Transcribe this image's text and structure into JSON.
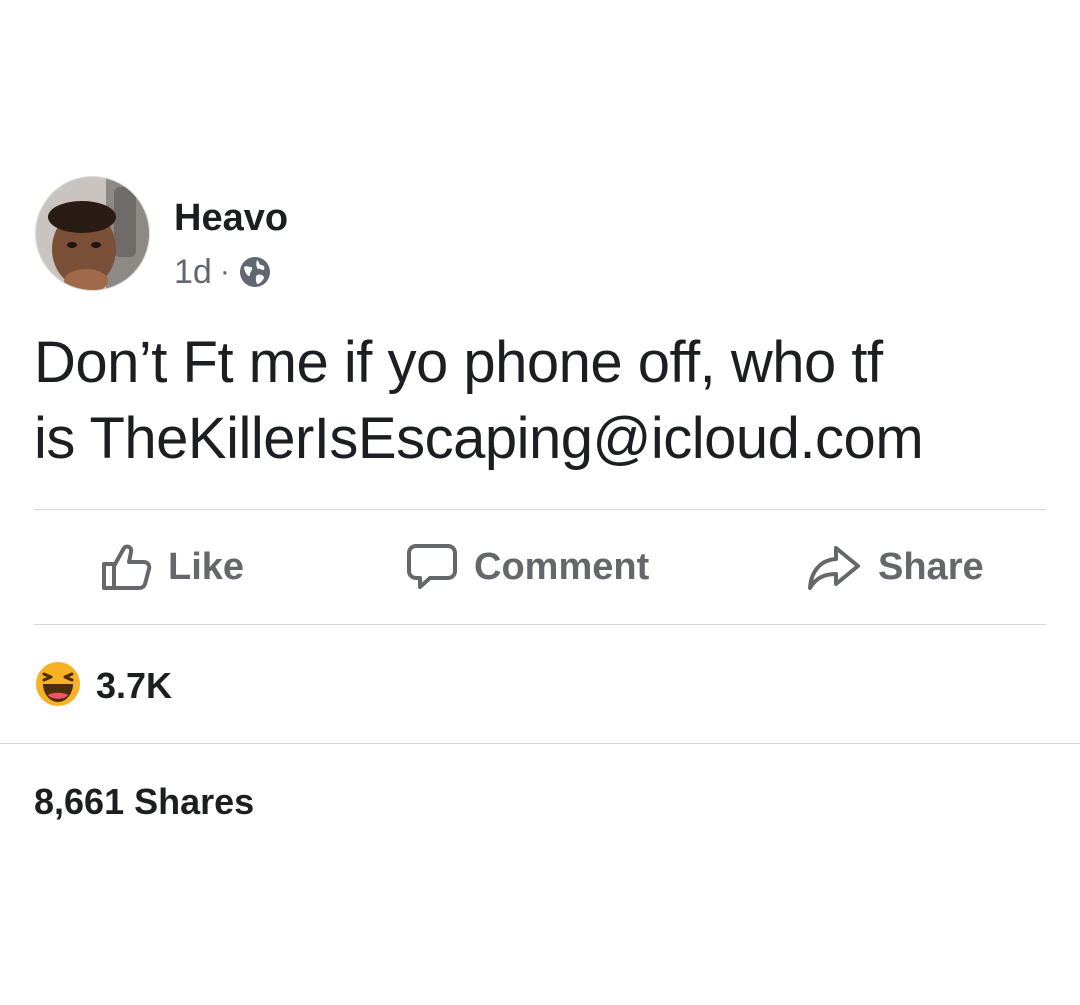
{
  "post": {
    "author": {
      "name": "Heavo"
    },
    "time": "1d",
    "separator": "·",
    "privacy_icon": "globe-icon",
    "text": "Don’t Ft me if yo phone off, who tf\nis TheKillerIsEscaping@icloud.com"
  },
  "actions": {
    "like_label": "Like",
    "like_icon": "thumbs-up-icon",
    "comment_label": "Comment",
    "comment_icon": "speech-bubble-icon",
    "share_label": "Share",
    "share_icon": "share-arrow-icon"
  },
  "engagement": {
    "reaction_icon": "haha-emoji-icon",
    "reaction_count": "3.7K",
    "shares": "8,661 Shares"
  },
  "colors": {
    "text_primary": "#1c1e21",
    "text_secondary": "#65676b",
    "divider": "#d6d6d6",
    "haha_yellow": "#f7b125"
  }
}
